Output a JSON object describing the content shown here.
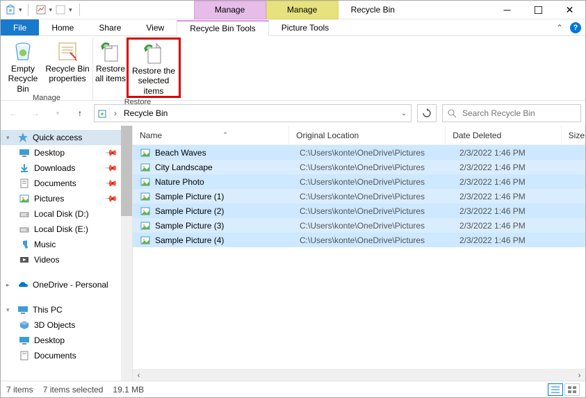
{
  "window": {
    "title": "Recycle Bin"
  },
  "context_tabs": {
    "recycle": "Manage",
    "picture": "Manage"
  },
  "tabs": {
    "file": "File",
    "home": "Home",
    "share": "Share",
    "view": "View",
    "recycle": "Recycle Bin Tools",
    "picture": "Picture Tools"
  },
  "ribbon": {
    "empty": "Empty Recycle Bin",
    "properties": "Recycle Bin properties",
    "restore_all": "Restore all items",
    "restore_sel": "Restore the selected items",
    "group_manage": "Manage",
    "group_restore": "Restore"
  },
  "address": {
    "location": "Recycle Bin",
    "search_placeholder": "Search Recycle Bin"
  },
  "nav": {
    "quick_access": "Quick access",
    "desktop": "Desktop",
    "downloads": "Downloads",
    "documents": "Documents",
    "pictures": "Pictures",
    "local_d": "Local Disk (D:)",
    "local_e": "Local Disk (E:)",
    "music": "Music",
    "videos": "Videos",
    "onedrive": "OneDrive - Personal",
    "this_pc": "This PC",
    "objects3d": "3D Objects",
    "pc_desktop": "Desktop",
    "pc_documents": "Documents"
  },
  "columns": {
    "name": "Name",
    "location": "Original Location",
    "date": "Date Deleted",
    "size": "Size"
  },
  "items": [
    {
      "name": "Beach Waves",
      "loc": "C:\\Users\\konte\\OneDrive\\Pictures",
      "date": "2/3/2022 1:46 PM"
    },
    {
      "name": "City Landscape",
      "loc": "C:\\Users\\konte\\OneDrive\\Pictures",
      "date": "2/3/2022 1:46 PM"
    },
    {
      "name": "Nature Photo",
      "loc": "C:\\Users\\konte\\OneDrive\\Pictures",
      "date": "2/3/2022 1:46 PM"
    },
    {
      "name": "Sample Picture (1)",
      "loc": "C:\\Users\\konte\\OneDrive\\Pictures",
      "date": "2/3/2022 1:46 PM"
    },
    {
      "name": "Sample Picture (2)",
      "loc": "C:\\Users\\konte\\OneDrive\\Pictures",
      "date": "2/3/2022 1:46 PM"
    },
    {
      "name": "Sample Picture (3)",
      "loc": "C:\\Users\\konte\\OneDrive\\Pictures",
      "date": "2/3/2022 1:46 PM"
    },
    {
      "name": "Sample Picture (4)",
      "loc": "C:\\Users\\konte\\OneDrive\\Pictures",
      "date": "2/3/2022 1:46 PM"
    }
  ],
  "status": {
    "count": "7 items",
    "selected": "7 items selected",
    "size": "19.1 MB"
  }
}
